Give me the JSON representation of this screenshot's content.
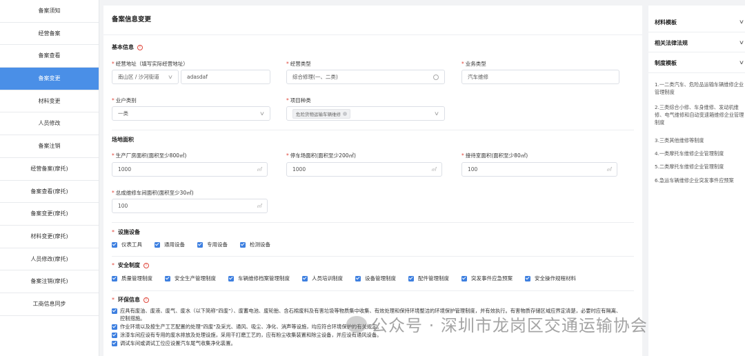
{
  "sidebar": {
    "items": [
      {
        "label": "备案须知",
        "active": false
      },
      {
        "label": "经营备案",
        "active": false
      },
      {
        "label": "备案查看",
        "active": false
      },
      {
        "label": "备案变更",
        "active": true
      },
      {
        "label": "材料变更",
        "active": false
      },
      {
        "label": "人员修改",
        "active": false
      },
      {
        "label": "备案注销",
        "active": false
      },
      {
        "label": "经营备案(摩托)",
        "active": false
      },
      {
        "label": "备案查看(摩托)",
        "active": false
      },
      {
        "label": "备案变更(摩托)",
        "active": false
      },
      {
        "label": "材料变更(摩托)",
        "active": false
      },
      {
        "label": "人员修改(摩托)",
        "active": false
      },
      {
        "label": "备案注销(摩托)",
        "active": false
      },
      {
        "label": "工商信息同步",
        "active": false
      }
    ]
  },
  "main": {
    "title": "备案信息变更",
    "basic": {
      "title": "基本信息",
      "address_label": "经营地址（填写实际经营地址）",
      "address_region": "南山区 / 沙河街道",
      "address_detail": "adasdaf",
      "business_type_label": "经营类型",
      "business_type_value": "综合修理(一、二类)",
      "service_type_label": "业务类型",
      "service_type_value": "汽车维修",
      "household_label": "业户类别",
      "household_value": "一类",
      "project_label": "项目种类",
      "project_tag": "危险货物运输车辆维修"
    },
    "site": {
      "title": "场地面积",
      "production_label": "生产厂房面积(面积至少800㎡)",
      "production_value": "1000",
      "parking_label": "停车场面积(面积至少200㎡)",
      "parking_value": "1000",
      "reception_label": "接待室面积(面积至少80㎡)",
      "reception_value": "100",
      "assembly_label": "总成维修车间面积(面积至少30㎡)",
      "assembly_value": "100",
      "unit": "㎡"
    },
    "equipment": {
      "title": "设施设备",
      "items": [
        "仪表工具",
        "通用设备",
        "专用设备",
        "检测设备"
      ]
    },
    "safety": {
      "title": "安全制度",
      "items": [
        "质量管理制度",
        "安全生产管理制度",
        "车辆维修档案管理制度",
        "人员培训制度",
        "设备管理制度",
        "配件管理制度",
        "突发事件应急预案",
        "安全操作规程材料"
      ]
    },
    "env": {
      "title": "环保信息",
      "items": [
        "应具有废油、废液、废气、废水（以下简称“四废”）、废蓄电池、废轮胎、含石棉废料及有害垃圾等物质集中收集、有效处理和保持环境整洁的环境保护管理制度，并有效执行。有害物质存储区域应界定清楚，必要时应有隔离、控制措施。",
        "作业环境以及按生产工艺配置的处理“四废”及采光、通风、吸尘、净化、消声等设施，均应符合环境保护的有关规定。",
        "涂漆车间应设有专用的废水排放及处理设施，采用干打磨工艺的，应有粉尘收集装置和除尘设备，并应设有通风设备。",
        "调试车间或调试工位应设置汽车尾气收集净化装置。"
      ]
    }
  },
  "right": {
    "sections": [
      {
        "title": "材料模板"
      },
      {
        "title": "相关法律法规"
      },
      {
        "title": "制度模板"
      }
    ],
    "links": [
      "1.一二类汽车、危险品运输车辆维修企业管理制度",
      "2.三类综合小修、车身维修、发动机维修、电气维修和自动变速箱维修企业管理制度",
      "3.三类其他维修等制度",
      "4.一类摩托车维修企业管理制度",
      "5.二类摩托车维修企业管理制度",
      "6.急运车辆维修企业突发事件应预案"
    ]
  },
  "watermark": "公众号 · 深圳市龙岗区交通运输协会",
  "colors": {
    "accent": "#4a8fe7",
    "checkbox": "#3d7fe0",
    "required": "#e0453a"
  }
}
